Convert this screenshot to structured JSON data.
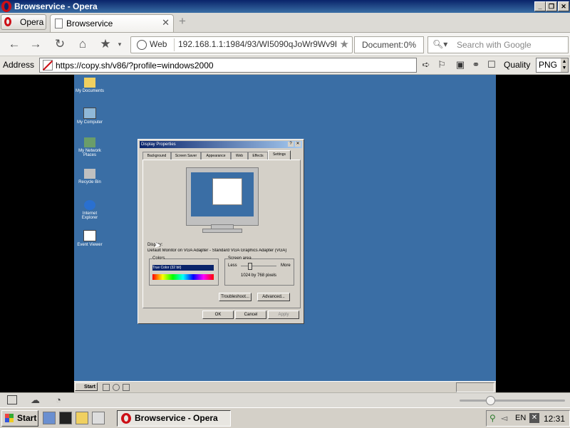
{
  "window": {
    "title": "Browservice - Opera"
  },
  "tabbar": {
    "menu_label": "Opera",
    "tab_label": "Browservice",
    "new_tab_glyph": "+"
  },
  "navbar": {
    "web_label": "Web",
    "url": "192.168.1.1:1984/93/WI5090qJoWr9Wv9B52",
    "document_label": "Document:",
    "document_value": "0%",
    "search_placeholder": "Search with Google"
  },
  "addressbar": {
    "label": "Address",
    "url": "https://copy.sh/v86/?profile=windows2000",
    "quality_label": "Quality",
    "quality_value": "PNG"
  },
  "remote": {
    "desktop_icons": [
      "My Documents",
      "My Computer",
      "My Network Places",
      "Recycle Bin",
      "Internet Explorer",
      "Event Viewer"
    ],
    "dialog": {
      "title": "Display Properties",
      "tabs": [
        "Background",
        "Screen Saver",
        "Appearance",
        "Web",
        "Effects",
        "Settings"
      ],
      "display_label": "Display:",
      "display_value": "Default Monitor on VGA Adapter - Standard VGA Graphics Adapter (VGA)",
      "colors_label": "Colors",
      "colors_value": "True Color (32 bit)",
      "area_label": "Screen area",
      "area_less": "Less",
      "area_more": "More",
      "area_value": "1024 by 768 pixels",
      "troubleshoot": "Troubleshoot...",
      "advanced": "Advanced...",
      "ok": "OK",
      "cancel": "Cancel",
      "apply": "Apply"
    },
    "taskbar": {
      "start": "Start",
      "clock": ""
    }
  },
  "taskbar": {
    "start": "Start",
    "task_label": "Browservice - Opera",
    "lang": "EN",
    "clock": "12:31"
  },
  "colors": {
    "titlebar": "#0a246a",
    "desktop": "#3a6ea5",
    "opera_red": "#cc0f16"
  }
}
